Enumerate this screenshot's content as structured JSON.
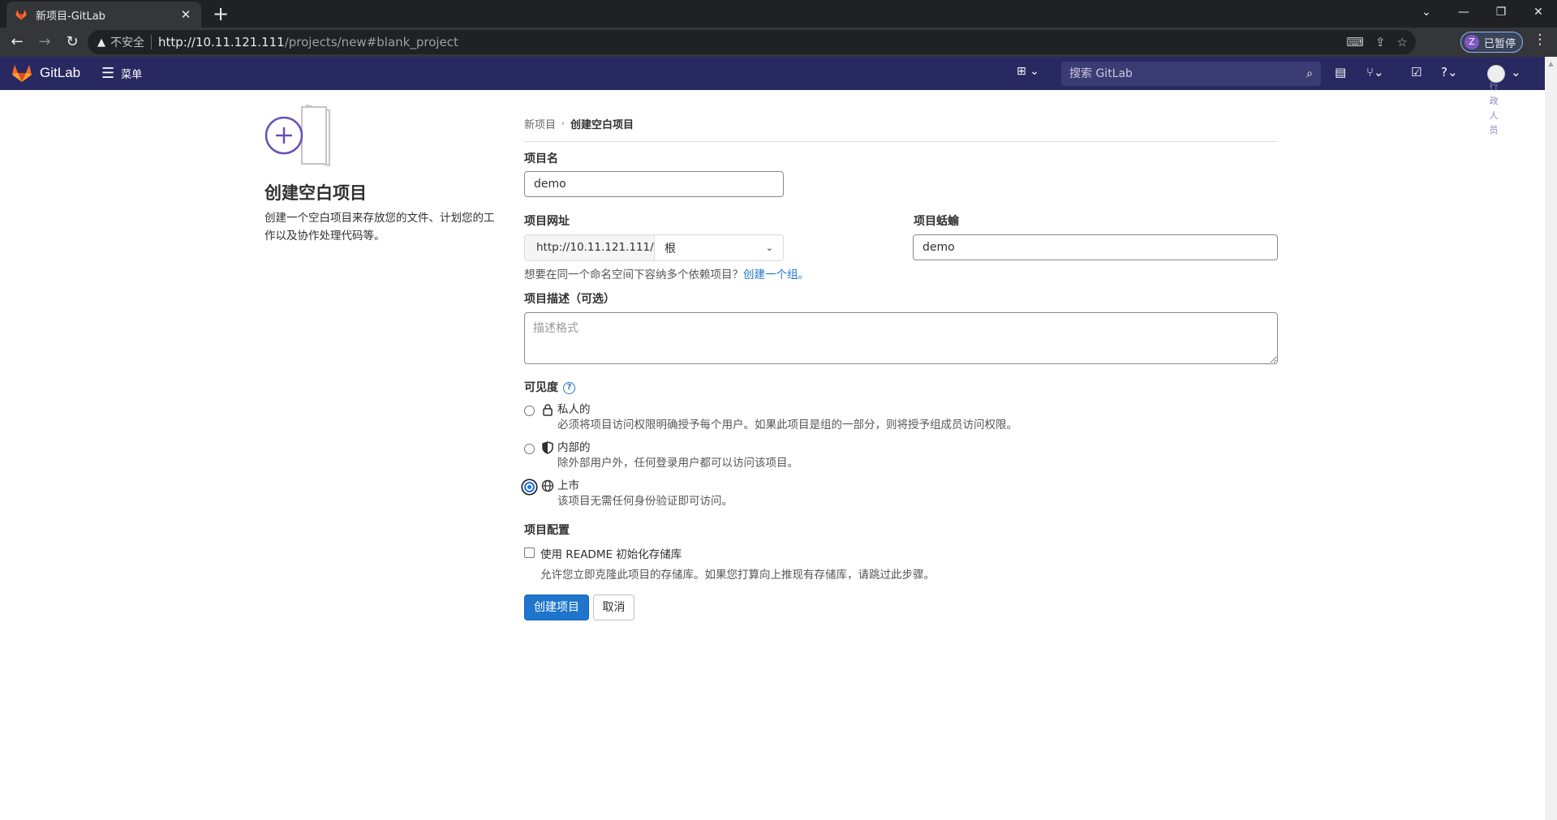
{
  "browser": {
    "tab_title": "新项目-GitLab",
    "tab_close": "✕",
    "new_tab": "+",
    "insecure_label": "不安全",
    "url_host": "http://10.11.121.111",
    "url_path": "/projects/new#blank_project",
    "profile_initial": "Z",
    "profile_label": "已暂停"
  },
  "gitlab": {
    "brand": "GitLab",
    "menu_label": "菜单",
    "search_placeholder": "搜索 GitLab",
    "accent": "#292961"
  },
  "side_vertical_text": "行政人员",
  "left_pane": {
    "title": "创建空白项目",
    "description": "创建一个空白项目来存放您的文件、计划您的工作以及协作处理代码等。"
  },
  "breadcrumb": {
    "parent": "新项目",
    "current": "创建空白项目"
  },
  "form": {
    "project_name_label": "项目名",
    "project_name_value": "demo",
    "project_url_label": "项目网址",
    "url_prefix": "http://10.11.121.111/",
    "namespace_value": "根",
    "slug_label": "项目蛞蝓",
    "slug_value": "demo",
    "group_help": "想要在同一个命名空间下容纳多个依赖项目？",
    "group_link": "创建一个组。",
    "description_label": "项目描述（可选）",
    "description_placeholder": "描述格式",
    "visibility_label": "可见度",
    "visibility": [
      {
        "title": "私人的",
        "desc": "必须将项目访问权限明确授予每个用户。如果此项目是组的一部分，则将授予组成员访问权限。",
        "icon": "lock-icon",
        "checked": false
      },
      {
        "title": "内部的",
        "desc": "除外部用户外，任何登录用户都可以访问该项目。",
        "icon": "shield-icon",
        "checked": false
      },
      {
        "title": "上市",
        "desc": "该项目无需任何身份验证即可访问。",
        "icon": "globe-icon",
        "checked": true
      }
    ],
    "config_label": "项目配置",
    "readme_label": "使用 README 初始化存储库",
    "readme_help": "允许您立即克隆此项目的存储库。如果您打算向上推现有存储库，请跳过此步骤。",
    "create_button": "创建项目",
    "cancel_button": "取消"
  }
}
